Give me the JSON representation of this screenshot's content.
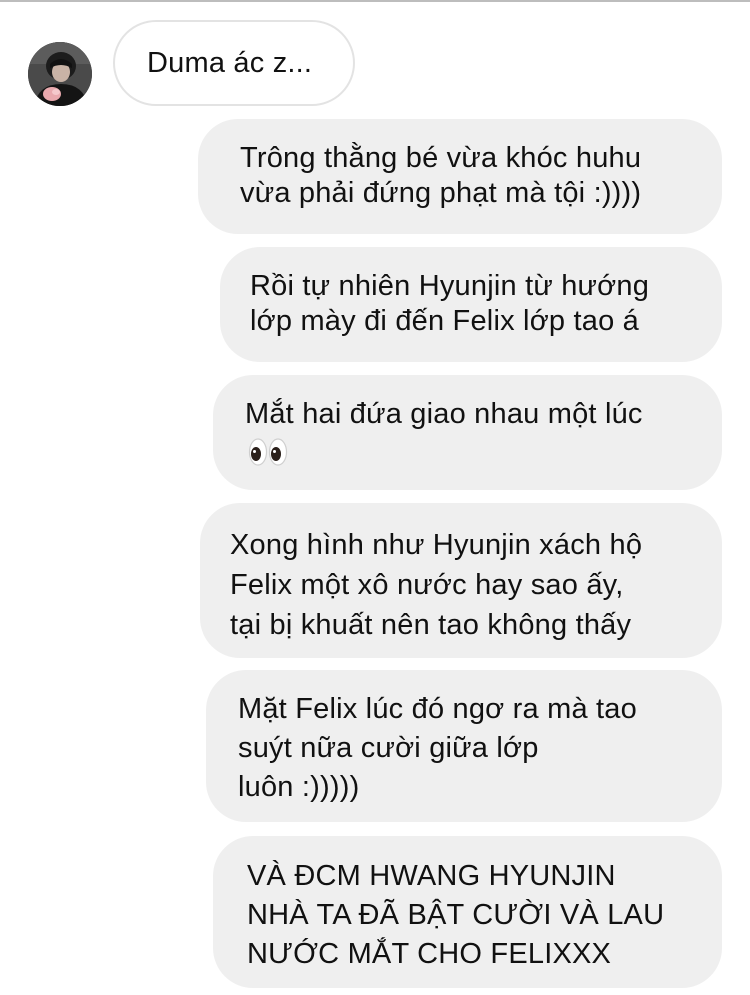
{
  "conversation": {
    "received": {
      "avatar": "user-avatar-photo",
      "text": "Duma ác z..."
    },
    "sent_messages": [
      {
        "text": "Trông thằng bé vừa khóc huhu\nvừa phải đứng phạt mà tội :))))"
      },
      {
        "text": "Rồi tự nhiên Hyunjin từ hướng\nlớp mày đi đến Felix lớp tao á"
      },
      {
        "text": "Mắt hai đứa giao nhau một lúc",
        "emoji": "eyes-emoji"
      },
      {
        "text": "Xong hình như Hyunjin xách hộ\nFelix một xô nước hay sao ấy,\ntại bị khuất nên tao không thấy"
      },
      {
        "text": "Mặt Felix lúc đó ngơ ra mà tao\nsuýt nữa cười giữa lớp\nluôn :)))))"
      },
      {
        "text": "VÀ ĐCM HWANG HYUNJIN\nNHÀ TA ĐÃ BẬT CƯỜI VÀ LAU\nNƯỚC MẮT CHO FELIXXX"
      }
    ]
  },
  "colors": {
    "sent_bubble": "#efefef",
    "received_border": "#e3e3e3",
    "text": "#111111"
  }
}
